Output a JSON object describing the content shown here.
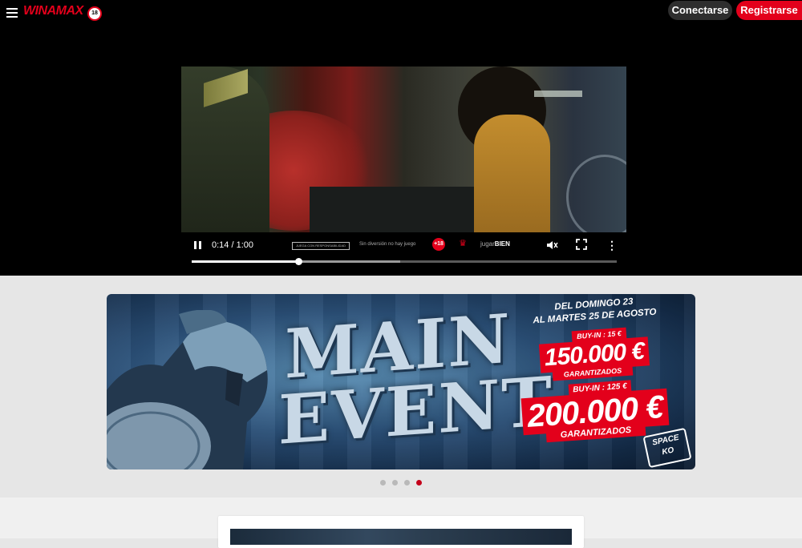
{
  "header": {
    "logo_text": "WINAMAX",
    "age_badge": "18",
    "login_label": "Conectarse",
    "register_label": "Registrarse"
  },
  "video": {
    "current_time": "0:14",
    "duration": "1:00",
    "time_display": "0:14 / 1:00",
    "progress": 0.25,
    "buffered": 0.49,
    "watermark": {
      "responsible_box": "JUEGA CON RESPONSABILIDAD",
      "slogan": "Sin diversión no hay juego",
      "age": "+18",
      "jugar": "jugar",
      "bien": "BIEN"
    },
    "icons": [
      "pause-icon",
      "mute-icon",
      "fullscreen-icon",
      "more-icon"
    ]
  },
  "banner": {
    "title_line1": "MAIN",
    "title_line2": "EVENT",
    "dates_line1": "DEL DOMINGO 23",
    "dates_line2": "AL MARTES 25 DE AGOSTO",
    "buyin1": "BUY-IN : 15 €",
    "prize1": "150.000 €",
    "guaranteed1": "GARANTIZADOS",
    "buyin2": "BUY-IN : 125 €",
    "prize2": "200.000 €",
    "guaranteed2": "GARANTIZADOS",
    "badge_line1": "SPACE",
    "badge_line2": "KO"
  },
  "carousel": {
    "count": 4,
    "active_index": 3
  },
  "colors": {
    "brand_red": "#e3001b",
    "dot_active": "#c4001a",
    "dot_inactive": "#b9b9b9"
  }
}
